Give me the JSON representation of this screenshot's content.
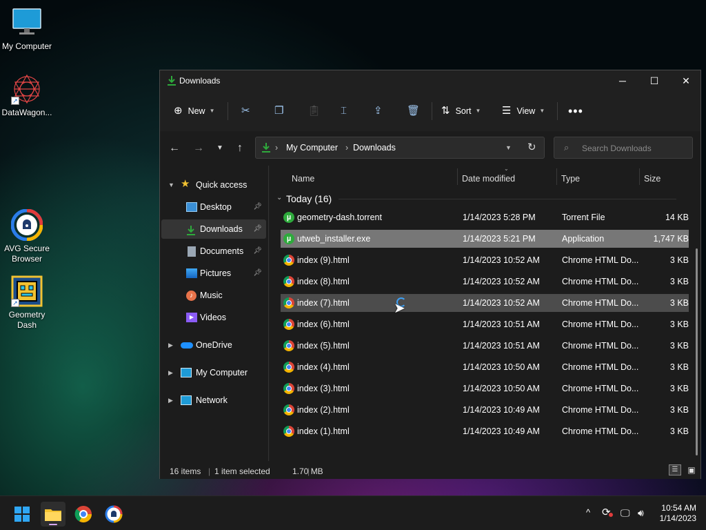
{
  "desktop": {
    "icons": [
      {
        "label": "My Computer",
        "icon": "monitor-icon"
      },
      {
        "label": "DataWagon...",
        "icon": "mandala-icon"
      },
      {
        "label": "AVG Secure Browser",
        "icon": "avg-browser-icon"
      },
      {
        "label": "Geometry Dash",
        "icon": "geometry-dash-icon"
      }
    ]
  },
  "window": {
    "title": "Downloads",
    "commands": {
      "new": "New",
      "sort": "Sort",
      "view": "View"
    },
    "address": {
      "crumbs": [
        "My Computer",
        "Downloads"
      ]
    },
    "search_placeholder": "Search Downloads",
    "nav": {
      "quick_access": "Quick access",
      "items": [
        "Desktop",
        "Downloads",
        "Documents",
        "Pictures",
        "Music",
        "Videos"
      ],
      "onedrive": "OneDrive",
      "my_computer": "My Computer",
      "network": "Network"
    },
    "columns": {
      "name": "Name",
      "date": "Date modified",
      "type": "Type",
      "size": "Size"
    },
    "group": "Today (16)",
    "files": [
      {
        "name": "geometry-dash.torrent",
        "date": "1/14/2023 5:28 PM",
        "type": "Torrent File",
        "size": "14 KB",
        "icon": "utorrent-icon"
      },
      {
        "name": "utweb_installer.exe",
        "date": "1/14/2023 5:21 PM",
        "type": "Application",
        "size": "1,747 KB",
        "icon": "utorrent-icon"
      },
      {
        "name": "index (9).html",
        "date": "1/14/2023 10:52 AM",
        "type": "Chrome HTML Do...",
        "size": "3 KB",
        "icon": "chrome-icon"
      },
      {
        "name": "index (8).html",
        "date": "1/14/2023 10:52 AM",
        "type": "Chrome HTML Do...",
        "size": "3 KB",
        "icon": "chrome-icon"
      },
      {
        "name": "index (7).html",
        "date": "1/14/2023 10:52 AM",
        "type": "Chrome HTML Do...",
        "size": "3 KB",
        "icon": "chrome-icon"
      },
      {
        "name": "index (6).html",
        "date": "1/14/2023 10:51 AM",
        "type": "Chrome HTML Do...",
        "size": "3 KB",
        "icon": "chrome-icon"
      },
      {
        "name": "index (5).html",
        "date": "1/14/2023 10:51 AM",
        "type": "Chrome HTML Do...",
        "size": "3 KB",
        "icon": "chrome-icon"
      },
      {
        "name": "index (4).html",
        "date": "1/14/2023 10:50 AM",
        "type": "Chrome HTML Do...",
        "size": "3 KB",
        "icon": "chrome-icon"
      },
      {
        "name": "index (3).html",
        "date": "1/14/2023 10:50 AM",
        "type": "Chrome HTML Do...",
        "size": "3 KB",
        "icon": "chrome-icon"
      },
      {
        "name": "index (2).html",
        "date": "1/14/2023 10:49 AM",
        "type": "Chrome HTML Do...",
        "size": "3 KB",
        "icon": "chrome-icon"
      },
      {
        "name": "index (1).html",
        "date": "1/14/2023 10:49 AM",
        "type": "Chrome HTML Do...",
        "size": "3 KB",
        "icon": "chrome-icon"
      }
    ],
    "status": {
      "count": "16 items",
      "selected": "1 item selected",
      "size": "1.70 MB"
    }
  },
  "taskbar": {
    "time": "10:54 AM",
    "date": "1/14/2023"
  },
  "colors": {
    "accent_green": "#2eaa3c",
    "selection": "#777777",
    "window_bg": "#1f1f1f"
  }
}
